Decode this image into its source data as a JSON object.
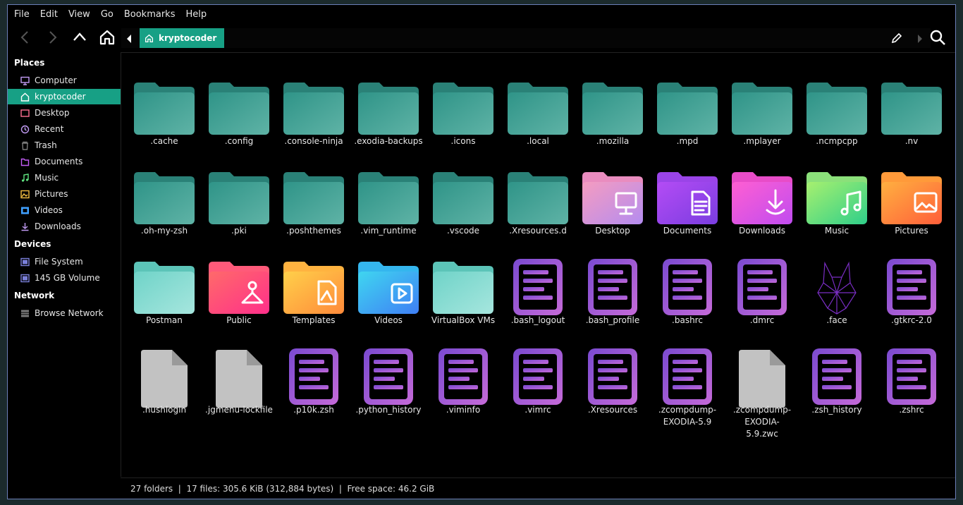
{
  "menubar": {
    "items": [
      "File",
      "Edit",
      "View",
      "Go",
      "Bookmarks",
      "Help"
    ]
  },
  "toolbar": {
    "back_icon": "chevron-left-icon",
    "forward_icon": "chevron-right-icon",
    "up_icon": "chevron-up-icon",
    "home_icon": "home-icon",
    "search_icon": "search-icon",
    "edit_icon": "pencil-icon"
  },
  "pathbar": {
    "crumb": "kryptocoder"
  },
  "sidebar": {
    "places_title": "Places",
    "places": [
      {
        "label": "Computer",
        "icon": "computer-icon",
        "color": "#c39cf5",
        "active": false
      },
      {
        "label": "kryptocoder",
        "icon": "home-icon",
        "color": "#ffffff",
        "active": true
      },
      {
        "label": "Desktop",
        "icon": "desktop-icon",
        "color": "#ff6f91",
        "active": false
      },
      {
        "label": "Recent",
        "icon": "recent-icon",
        "color": "#c39cf5",
        "active": false
      },
      {
        "label": "Trash",
        "icon": "trash-icon",
        "color": "#7a7a7a",
        "active": false
      },
      {
        "label": "Documents",
        "icon": "documents-icon",
        "color": "#c35cf5",
        "active": false
      },
      {
        "label": "Music",
        "icon": "music-icon",
        "color": "#5ee07e",
        "active": false
      },
      {
        "label": "Pictures",
        "icon": "pictures-icon",
        "color": "#f5c042",
        "active": false
      },
      {
        "label": "Videos",
        "icon": "videos-icon",
        "color": "#3fa0ff",
        "active": false
      },
      {
        "label": "Downloads",
        "icon": "downloads-icon",
        "color": "#c39cf5",
        "active": false
      }
    ],
    "devices_title": "Devices",
    "devices": [
      {
        "label": "File System",
        "icon": "drive-icon",
        "color": "#7a7fd9"
      },
      {
        "label": "145 GB Volume",
        "icon": "drive-icon",
        "color": "#7a7fd9"
      }
    ],
    "network_title": "Network",
    "network": [
      {
        "label": "Browse Network",
        "icon": "network-icon",
        "color": "#7a7a7a"
      }
    ]
  },
  "files": [
    {
      "name": ".cache",
      "type": "folder"
    },
    {
      "name": ".config",
      "type": "folder"
    },
    {
      "name": ".console-ninja",
      "type": "folder"
    },
    {
      "name": ".exodia-backups",
      "type": "folder"
    },
    {
      "name": ".icons",
      "type": "folder"
    },
    {
      "name": ".local",
      "type": "folder"
    },
    {
      "name": ".mozilla",
      "type": "folder"
    },
    {
      "name": ".mpd",
      "type": "folder"
    },
    {
      "name": ".mplayer",
      "type": "folder"
    },
    {
      "name": ".ncmpcpp",
      "type": "folder"
    },
    {
      "name": ".nv",
      "type": "folder"
    },
    {
      "name": ".oh-my-zsh",
      "type": "folder"
    },
    {
      "name": ".pki",
      "type": "folder"
    },
    {
      "name": ".poshthemes",
      "type": "folder"
    },
    {
      "name": ".vim_runtime",
      "type": "folder"
    },
    {
      "name": ".vscode",
      "type": "folder"
    },
    {
      "name": ".Xresources.d",
      "type": "folder"
    },
    {
      "name": "Desktop",
      "type": "desktop"
    },
    {
      "name": "Documents",
      "type": "documents"
    },
    {
      "name": "Downloads",
      "type": "downloads"
    },
    {
      "name": "Music",
      "type": "music"
    },
    {
      "name": "Pictures",
      "type": "pictures"
    },
    {
      "name": "Postman",
      "type": "folder-light"
    },
    {
      "name": "Public",
      "type": "public"
    },
    {
      "name": "Templates",
      "type": "templates"
    },
    {
      "name": "Videos",
      "type": "videos"
    },
    {
      "name": "VirtualBox VMs",
      "type": "folder-light"
    },
    {
      "name": ".bash_logout",
      "type": "text"
    },
    {
      "name": ".bash_profile",
      "type": "text"
    },
    {
      "name": ".bashrc",
      "type": "text"
    },
    {
      "name": ".dmrc",
      "type": "text"
    },
    {
      "name": ".face",
      "type": "image"
    },
    {
      "name": ".gtkrc-2.0",
      "type": "text"
    },
    {
      "name": ".hushlogin",
      "type": "blank"
    },
    {
      "name": ".jgmenu-lockfile",
      "type": "blank"
    },
    {
      "name": ".p10k.zsh",
      "type": "text"
    },
    {
      "name": ".python_history",
      "type": "text"
    },
    {
      "name": ".viminfo",
      "type": "text"
    },
    {
      "name": ".vimrc",
      "type": "text"
    },
    {
      "name": ".Xresources",
      "type": "text"
    },
    {
      "name": ".zcompdump-EXODIA-5.9",
      "type": "text"
    },
    {
      "name": ".zcompdump-EXODIA-5.9.zwc",
      "type": "blank"
    },
    {
      "name": ".zsh_history",
      "type": "text"
    },
    {
      "name": ".zshrc",
      "type": "text"
    }
  ],
  "statusbar": {
    "text": "27 folders  |  17 files: 305.6 KiB (312,884 bytes)  |  Free space: 46.2 GiB"
  },
  "colors": {
    "accent": "#17a085",
    "folder_teal": "#3fa79a",
    "text_file": "#a259d9"
  }
}
